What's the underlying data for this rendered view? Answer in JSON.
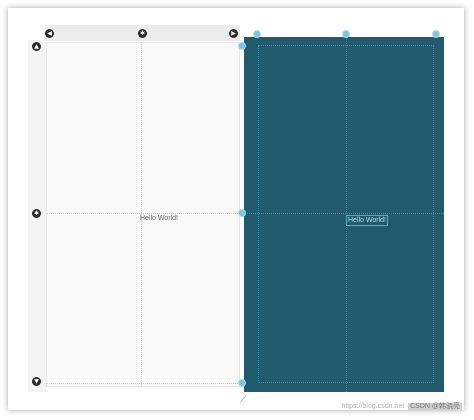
{
  "design_view": {
    "text_view_label": "Hello World!"
  },
  "blueprint_view": {
    "text_view_label": "Hello World!",
    "background_color": "#225a6d"
  },
  "icons": {
    "arrow_left": "arrow-left-icon",
    "arrow_right": "arrow-right-icon",
    "arrow_up": "arrow-up-icon",
    "arrow_down": "arrow-down-icon",
    "center_knob": "settings-knob-icon"
  },
  "watermark": {
    "site_text": "https://blog.csdn.net",
    "author_text": "CSDN @韩骁亮"
  }
}
